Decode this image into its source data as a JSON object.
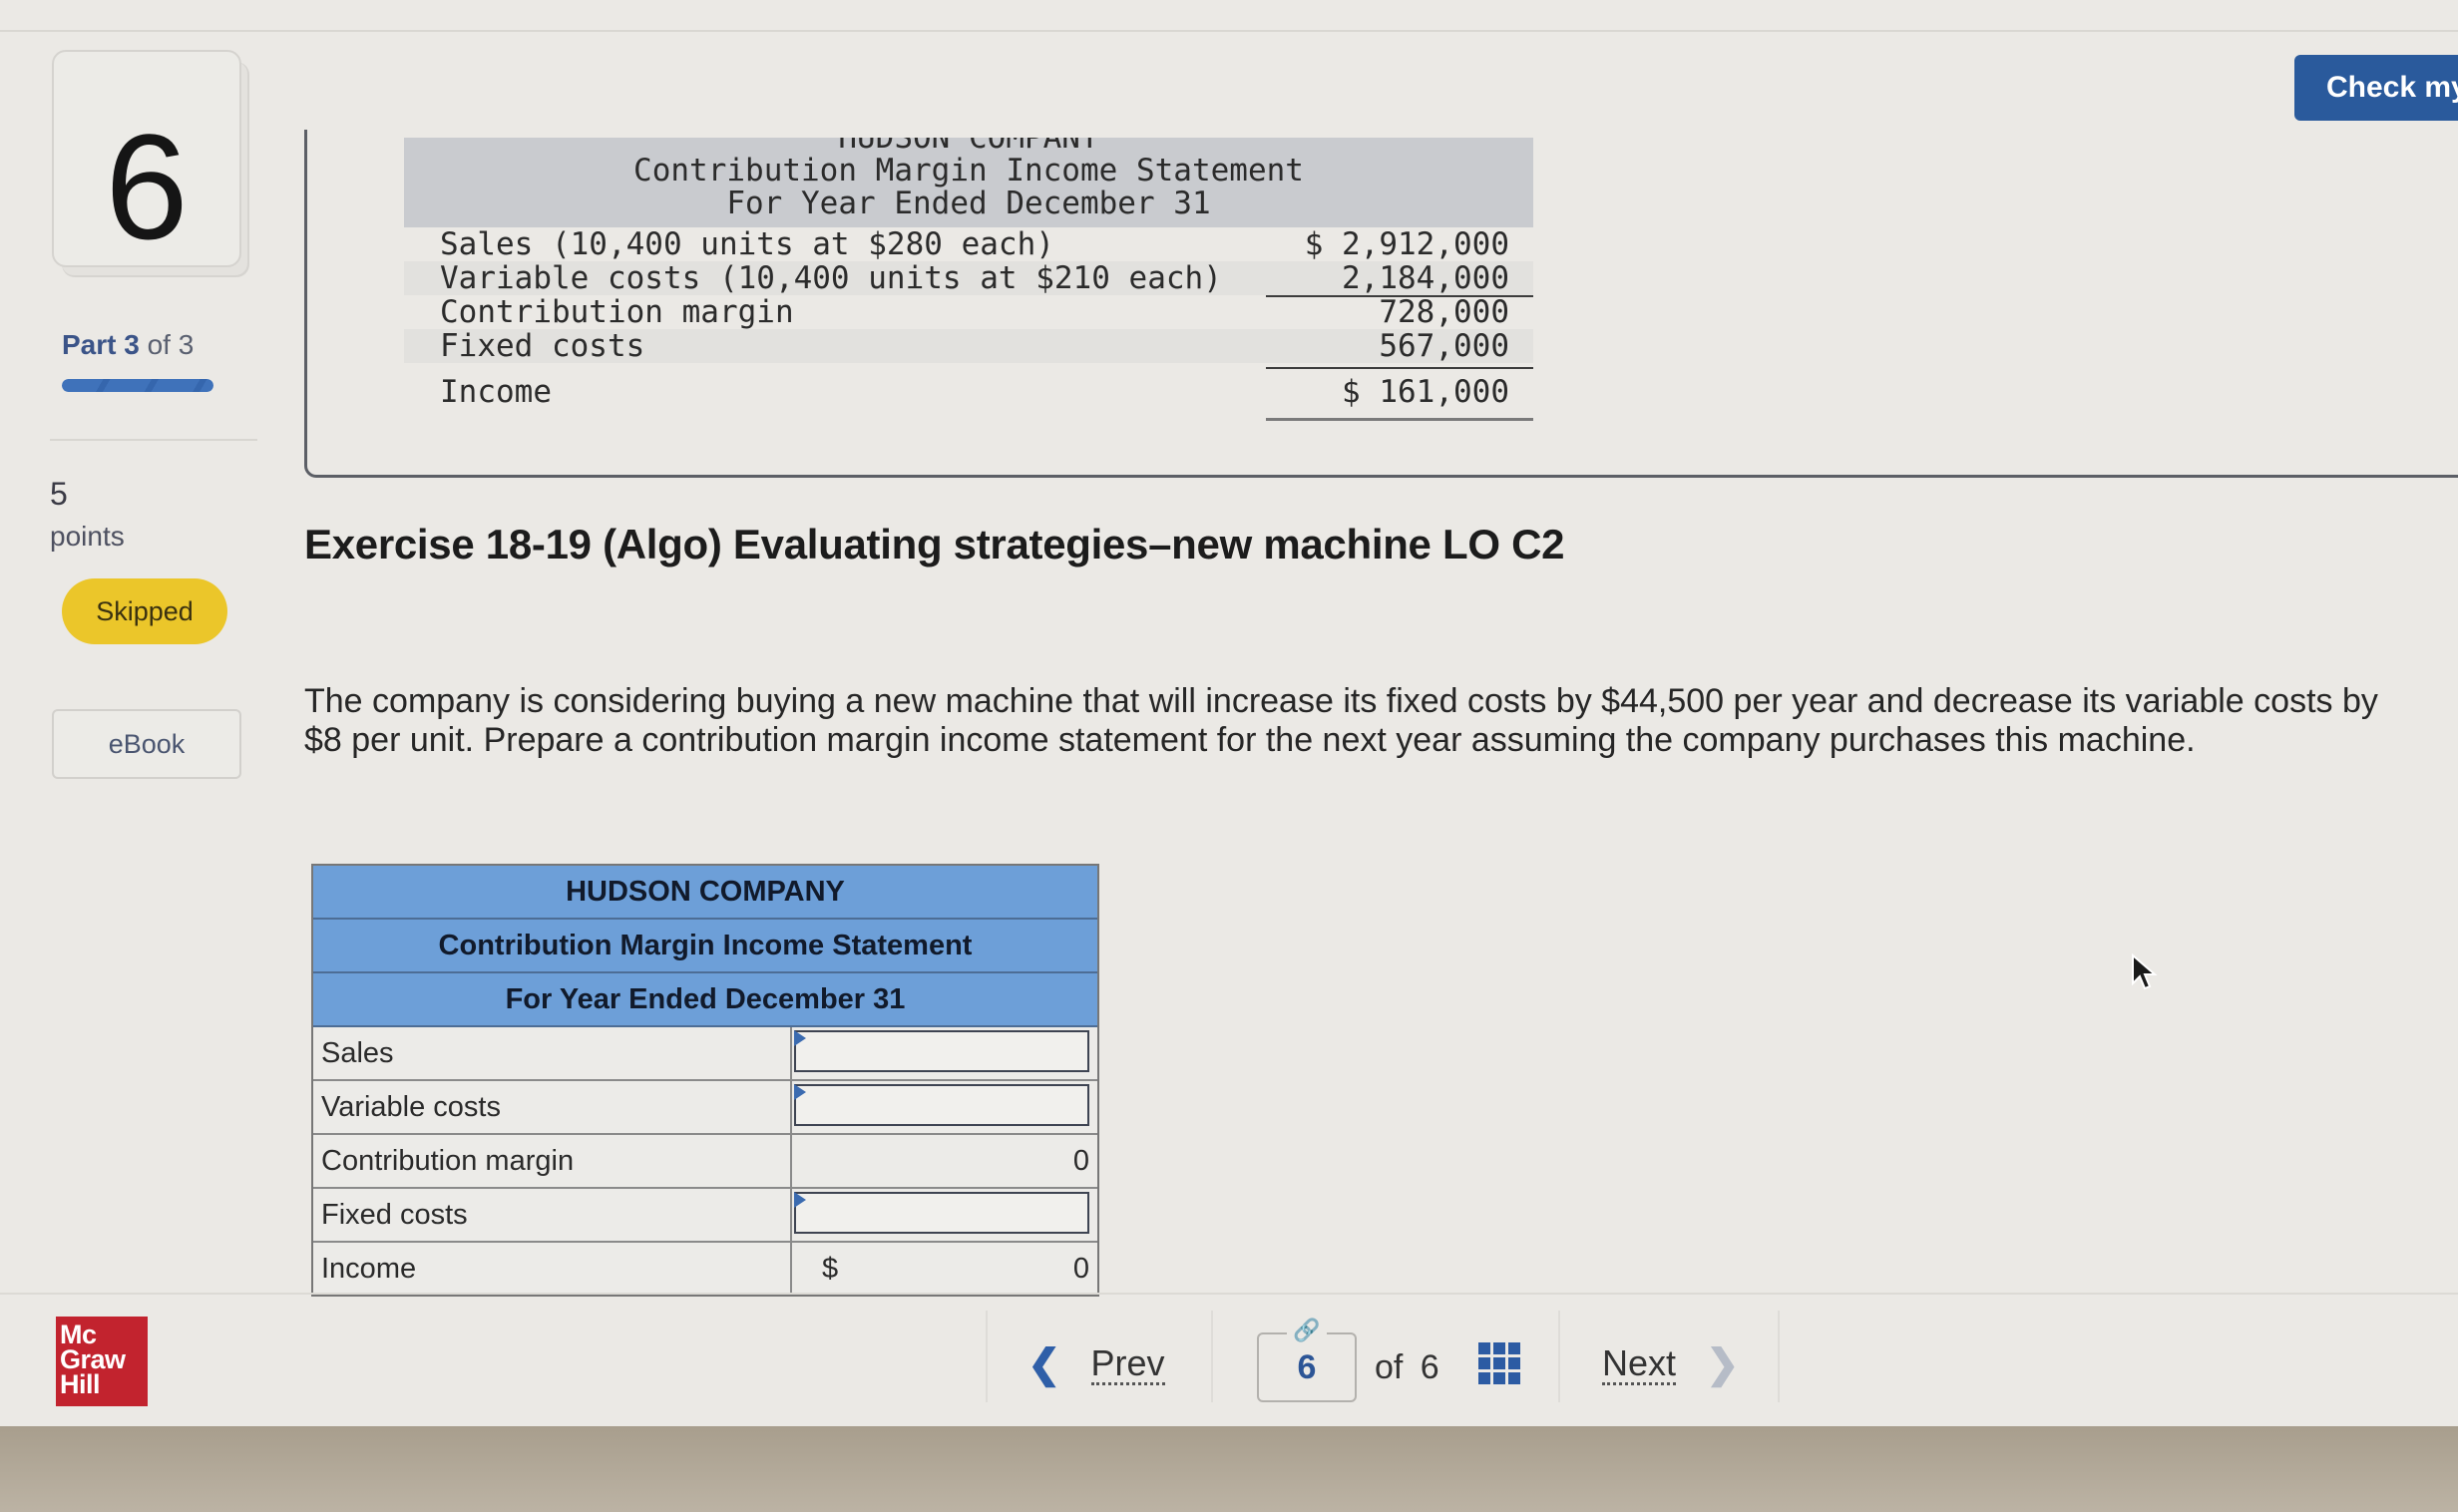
{
  "question": {
    "number": "6",
    "part_label_bold": "Part 3",
    "part_label_rest": " of 3",
    "progress_fraction": 1.0,
    "points_value": "5",
    "points_label": "points",
    "status_badge": "Skipped",
    "ebook_label": "eBook"
  },
  "header": {
    "check_button_label": "Check my work"
  },
  "reference_statement": {
    "company": "HUDSON COMPANY",
    "title": "Contribution Margin Income Statement",
    "period": "For Year Ended December 31",
    "rows": [
      {
        "label": "Sales (10,400 units at $280 each)",
        "amount": "$ 2,912,000"
      },
      {
        "label": "Variable costs (10,400 units at $210 each)",
        "amount": "2,184,000"
      },
      {
        "label": "Contribution margin",
        "amount": "728,000"
      },
      {
        "label": "Fixed costs",
        "amount": "567,000"
      },
      {
        "label": "Income",
        "amount": "$ 161,000"
      }
    ]
  },
  "exercise": {
    "title": "Exercise 18-19 (Algo) Evaluating strategies–new machine LO C2",
    "body": "The company is considering buying a new machine that will increase its fixed costs by $44,500 per year and decrease its variable costs by $8 per unit. Prepare a contribution margin income statement for the next year assuming the company purchases this machine."
  },
  "answer_table": {
    "company": "HUDSON COMPANY",
    "title": "Contribution Margin Income Statement",
    "period": "For Year Ended December 31",
    "rows": [
      {
        "label": "Sales",
        "value": ""
      },
      {
        "label": "Variable costs",
        "value": ""
      },
      {
        "label": "Contribution margin",
        "value": "0"
      },
      {
        "label": "Fixed costs",
        "value": ""
      },
      {
        "label": "Income",
        "currency": "$",
        "value": "0"
      }
    ]
  },
  "footer": {
    "logo_lines": [
      "Mc",
      "Graw",
      "Hill"
    ],
    "prev_label": "Prev",
    "current_page": "6",
    "of_text": "of 6",
    "next_label": "Next"
  },
  "colors": {
    "accent_blue": "#2a5a9c",
    "skipped_yellow": "#ebc62a",
    "table_header_blue": "#6d9fd8",
    "logo_red": "#c2232e"
  }
}
